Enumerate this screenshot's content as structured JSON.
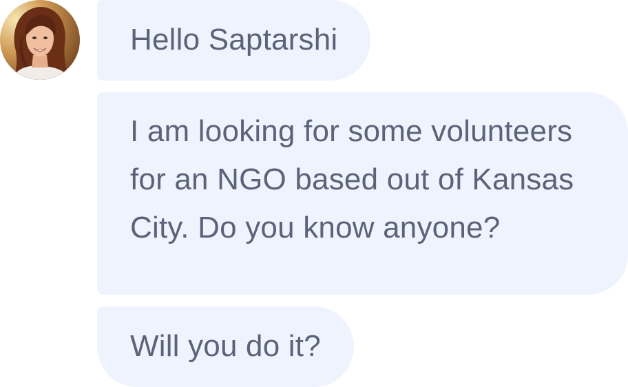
{
  "conversation": {
    "sender": {
      "avatar_icon": "person-avatar-photo"
    },
    "messages": [
      {
        "text": "Hello Saptarshi"
      },
      {
        "text": "I am looking for some volunteers for an NGO based out of Kansas City. Do you know anyone?"
      },
      {
        "text": "Will you do it?"
      }
    ],
    "colors": {
      "bubble_background": "#eff3fe",
      "message_text": "#5b6379",
      "page_background": "#ffffff"
    }
  }
}
